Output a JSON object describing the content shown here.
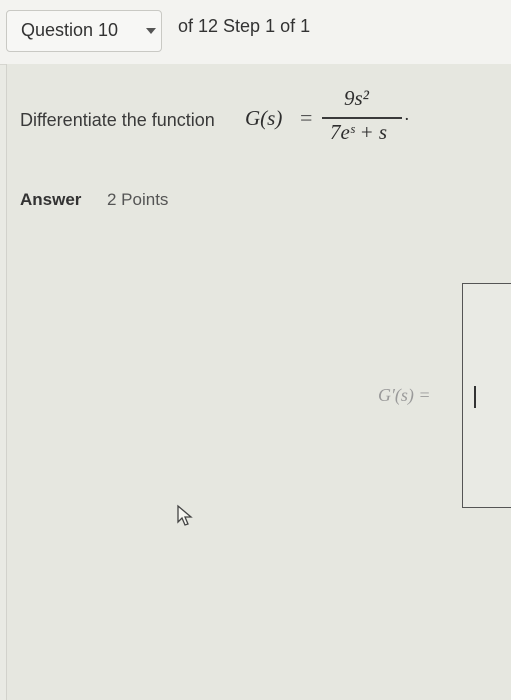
{
  "header": {
    "question_label": "Question 10",
    "step_text": "of 12 Step 1 of 1"
  },
  "question": {
    "prompt": "Differentiate the function",
    "function_name": "G(s)",
    "equals": "=",
    "numerator": "9s²",
    "denominator": "7eˢ + s",
    "period": "."
  },
  "answer": {
    "label": "Answer",
    "points": "2 Points",
    "input_prefix": "G′(s) ="
  },
  "icons": {
    "dropdown": "chevron-down-icon",
    "pointer": "mouse-pointer-icon"
  }
}
